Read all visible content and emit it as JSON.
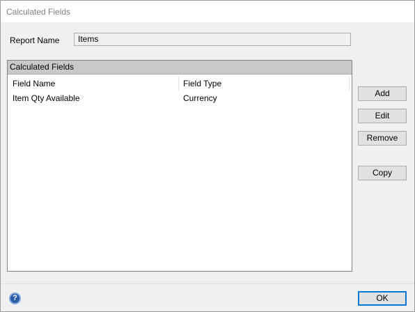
{
  "window": {
    "title": "Calculated Fields"
  },
  "report": {
    "label": "Report Name",
    "value": "Items"
  },
  "list": {
    "caption": "Calculated Fields",
    "columns": [
      "Field Name",
      "Field Type"
    ],
    "rows": [
      {
        "field_name": "Item Qty Available",
        "field_type": "Currency"
      }
    ]
  },
  "buttons": {
    "add": "Add",
    "edit": "Edit",
    "remove": "Remove",
    "copy": "Copy",
    "ok": "OK"
  },
  "icons": {
    "help": "help-icon"
  },
  "colors": {
    "ok_border": "#0078d7",
    "help_icon": "#2a5da8",
    "caption_bg": "#c9c9c9"
  }
}
